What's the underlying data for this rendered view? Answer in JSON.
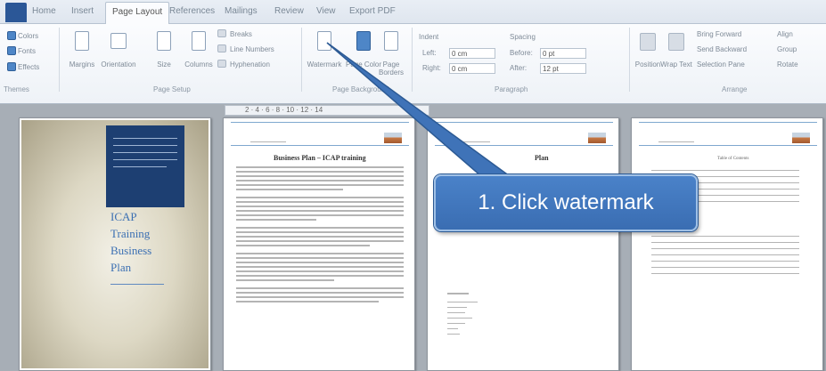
{
  "ribbon_tabs": [
    "Home",
    "Insert",
    "Page Layout",
    "References",
    "Mailings",
    "Review",
    "View",
    "Export PDF"
  ],
  "themes": {
    "colors": "Colors",
    "fonts": "Fonts",
    "effects": "Effects",
    "group": "Themes"
  },
  "page_setup": {
    "margins": "Margins",
    "orientation": "Orientation",
    "size": "Size",
    "columns": "Columns",
    "breaks": "Breaks",
    "line_numbers": "Line Numbers",
    "hyphenation": "Hyphenation",
    "group": "Page Setup"
  },
  "page_background": {
    "watermark": "Watermark",
    "page_color": "Page Color",
    "page_borders": "Page Borders",
    "group": "Page Background"
  },
  "paragraph": {
    "indent": "Indent",
    "spacing": "Spacing",
    "left_label": "Left:",
    "left_value": "0 cm",
    "right_label": "Right:",
    "right_value": "0 cm",
    "before_label": "Before:",
    "before_value": "0 pt",
    "after_label": "After:",
    "after_value": "12 pt",
    "group": "Paragraph"
  },
  "arrange": {
    "position": "Position",
    "wrap_text": "Wrap Text",
    "bring_forward": "Bring Forward",
    "send_backward": "Send Backward",
    "selection_pane": "Selection Pane",
    "align": "Align",
    "group_btn": "Group",
    "rotate": "Rotate",
    "group": "Arrange"
  },
  "ruler": {
    "ticks": "2 · 4 · 6 · 8 · 10 · 12 · 14"
  },
  "cover": {
    "line1": "ICAP",
    "line2": "Training",
    "line3": "Business",
    "line4": "Plan"
  },
  "page2": {
    "title": "Business Plan – ICAP training"
  },
  "page3": {
    "title": "Plan"
  },
  "page4": {
    "title": "Table of Contents"
  },
  "callout": {
    "text": "1. Click watermark"
  }
}
